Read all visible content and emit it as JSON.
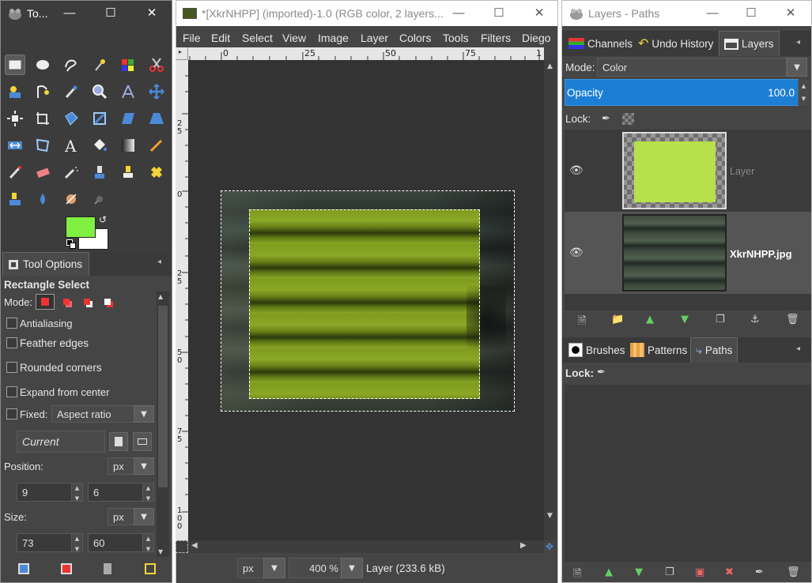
{
  "toolbox": {
    "title": "To...",
    "tools": [
      "rect-select",
      "ellipse-select",
      "free-select",
      "fuzzy-select",
      "select-by-color",
      "scissors-select",
      "foreground-select",
      "paths",
      "color-picker",
      "zoom",
      "measure",
      "move",
      "alignment",
      "crop",
      "unified-transform",
      "rotate",
      "shear",
      "perspective",
      "flip",
      "cage",
      "text",
      "bucket-fill",
      "blend",
      "pencil",
      "paintbrush",
      "eraser",
      "airbrush",
      "ink",
      "mypaint-brush",
      "heal",
      "clone",
      "smudge",
      "dodge-burn",
      "blur-sharpen"
    ],
    "fg_color": "#7ff041",
    "bg_color": "#ffffff",
    "tab_label": "Tool Options"
  },
  "tool_options": {
    "heading": "Rectangle Select",
    "mode_label": "Mode:",
    "antialiasing": "Antialiasing",
    "feather_edges": "Feather edges",
    "rounded_corners": "Rounded corners",
    "expand_from_center": "Expand from center",
    "fixed_label": "Fixed:",
    "fixed_value": "Aspect ratio",
    "current_value": "Current",
    "position_label": "Position:",
    "position_unit": "px",
    "position_x": "9",
    "position_y": "6",
    "size_label": "Size:",
    "size_unit": "px",
    "size_w": "73",
    "size_h": "60"
  },
  "image_window": {
    "title": "*[XkrNHPP] (imported)-1.0 (RGB color, 2 layers...",
    "menu": [
      "File",
      "Edit",
      "Select",
      "View",
      "Image",
      "Layer",
      "Colors",
      "Tools",
      "Filters",
      "Diego"
    ],
    "ruler_h_labels": [
      "0",
      "25",
      "50",
      "75",
      "1"
    ],
    "ruler_v_labels": [
      "2\n5",
      "0",
      "2\n5",
      "5\n0",
      "7\n5",
      "1\n0\n0"
    ],
    "status_unit": "px",
    "zoom": "400 %",
    "status_text": "Layer (233.6 kB)"
  },
  "layers_window": {
    "title": "Layers - Paths",
    "tabs": [
      "Channels",
      "Undo History",
      "Layers"
    ],
    "mode_label": "Mode:",
    "mode_value": "Color",
    "opacity_label": "Opacity",
    "opacity_value": "100.0",
    "lock_label": "Lock:",
    "layers": [
      {
        "name": "Layer",
        "color": "#b8e04a"
      },
      {
        "name": "XkrNHPP.jpg",
        "color": "#3a4a3a"
      }
    ],
    "bottom_tabs": [
      "Brushes",
      "Patterns",
      "Paths"
    ],
    "paths_lock_label": "Lock:"
  }
}
